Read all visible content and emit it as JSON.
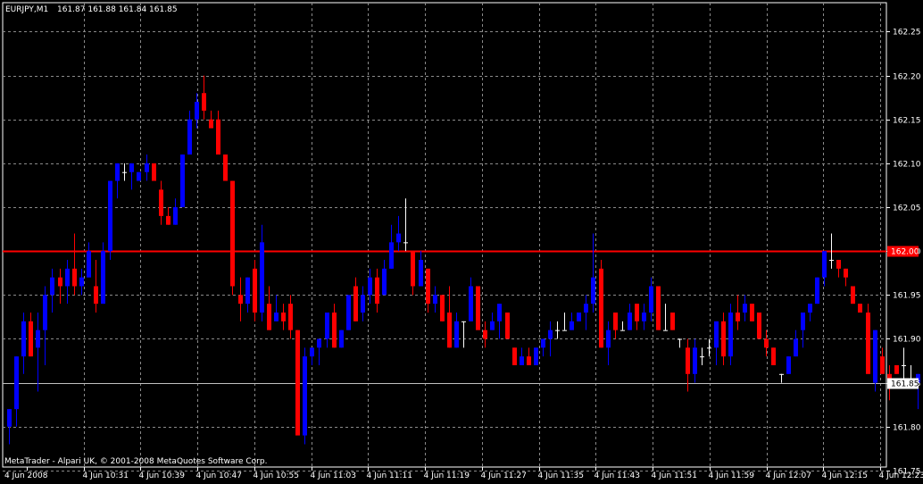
{
  "header": {
    "symbol": "EURJPY,M1",
    "ohlc": "161.87 161.88 161.84 161.85"
  },
  "footer": {
    "copyright": "MetaTrader - Alpari UK, © 2001-2008 MetaQuotes Software Corp."
  },
  "colors": {
    "background": "#000000",
    "grid": "#8a8a8a",
    "bull": "#0000ff",
    "bear": "#ff0000",
    "doji": "#ffffff",
    "level_line": "#ff0000",
    "bid_line": "#c0c0c0",
    "text": "#ffffff"
  },
  "chart_data": {
    "type": "candlestick",
    "title": "EURJPY,M1",
    "ylim": [
      161.754,
      162.283
    ],
    "y_ticks": [
      "162.25",
      "162.20",
      "162.15",
      "162.10",
      "162.05",
      "162.00",
      "161.95",
      "161.90",
      "161.85",
      "161.80",
      "161.75"
    ],
    "x_labels": [
      "4 Jun 2008",
      "4 Jun 10:31",
      "4 Jun 10:39",
      "4 Jun 10:47",
      "4 Jun 10:55",
      "4 Jun 11:03",
      "4 Jun 11:11",
      "4 Jun 11:19",
      "4 Jun 11:27",
      "4 Jun 11:35",
      "4 Jun 11:43",
      "4 Jun 11:51",
      "4 Jun 11:59",
      "4 Jun 12:07",
      "4 Jun 12:15",
      "4 Jun 12:23"
    ],
    "level_line": {
      "value": 162.0,
      "label": "162.00"
    },
    "bid_line": {
      "value": 161.85,
      "label": "161.85"
    },
    "grid": true,
    "candles": [
      {
        "o": 161.8,
        "h": 161.82,
        "l": 161.78,
        "c": 161.82
      },
      {
        "o": 161.82,
        "h": 161.88,
        "l": 161.8,
        "c": 161.88
      },
      {
        "o": 161.88,
        "h": 161.93,
        "l": 161.86,
        "c": 161.92
      },
      {
        "o": 161.92,
        "h": 161.93,
        "l": 161.88,
        "c": 161.88
      },
      {
        "o": 161.89,
        "h": 161.93,
        "l": 161.84,
        "c": 161.91
      },
      {
        "o": 161.91,
        "h": 161.96,
        "l": 161.87,
        "c": 161.95
      },
      {
        "o": 161.95,
        "h": 161.98,
        "l": 161.93,
        "c": 161.97
      },
      {
        "o": 161.97,
        "h": 161.98,
        "l": 161.94,
        "c": 161.96
      },
      {
        "o": 161.96,
        "h": 161.99,
        "l": 161.94,
        "c": 161.98
      },
      {
        "o": 161.98,
        "h": 162.02,
        "l": 161.95,
        "c": 161.96
      },
      {
        "o": 161.96,
        "h": 161.98,
        "l": 161.95,
        "c": 161.97
      },
      {
        "o": 161.97,
        "h": 162.01,
        "l": 161.97,
        "c": 162.0
      },
      {
        "o": 161.96,
        "h": 161.99,
        "l": 161.93,
        "c": 161.94
      },
      {
        "o": 161.94,
        "h": 162.01,
        "l": 161.94,
        "c": 162.0
      },
      {
        "o": 162.0,
        "h": 162.08,
        "l": 161.99,
        "c": 162.08
      },
      {
        "o": 162.08,
        "h": 162.1,
        "l": 162.06,
        "c": 162.1
      },
      {
        "o": 162.09,
        "h": 162.1,
        "l": 162.08,
        "c": 162.09
      },
      {
        "o": 162.09,
        "h": 162.1,
        "l": 162.07,
        "c": 162.1
      },
      {
        "o": 162.08,
        "h": 162.09,
        "l": 162.08,
        "c": 162.09
      },
      {
        "o": 162.09,
        "h": 162.11,
        "l": 162.08,
        "c": 162.1
      },
      {
        "o": 162.1,
        "h": 162.1,
        "l": 162.08,
        "c": 162.08
      },
      {
        "o": 162.07,
        "h": 162.08,
        "l": 162.03,
        "c": 162.04
      },
      {
        "o": 162.04,
        "h": 162.05,
        "l": 162.03,
        "c": 162.03
      },
      {
        "o": 162.03,
        "h": 162.06,
        "l": 162.03,
        "c": 162.05
      },
      {
        "o": 162.05,
        "h": 162.11,
        "l": 162.05,
        "c": 162.11
      },
      {
        "o": 162.11,
        "h": 162.16,
        "l": 162.11,
        "c": 162.15
      },
      {
        "o": 162.15,
        "h": 162.18,
        "l": 162.14,
        "c": 162.17
      },
      {
        "o": 162.18,
        "h": 162.2,
        "l": 162.15,
        "c": 162.16
      },
      {
        "o": 162.15,
        "h": 162.16,
        "l": 162.14,
        "c": 162.14
      },
      {
        "o": 162.15,
        "h": 162.16,
        "l": 162.11,
        "c": 162.11
      },
      {
        "o": 162.11,
        "h": 162.11,
        "l": 162.08,
        "c": 162.08
      },
      {
        "o": 162.08,
        "h": 162.08,
        "l": 161.95,
        "c": 161.96
      },
      {
        "o": 161.95,
        "h": 161.97,
        "l": 161.92,
        "c": 161.94
      },
      {
        "o": 161.94,
        "h": 161.97,
        "l": 161.93,
        "c": 161.97
      },
      {
        "o": 161.98,
        "h": 161.99,
        "l": 161.92,
        "c": 161.93
      },
      {
        "o": 161.93,
        "h": 162.03,
        "l": 161.92,
        "c": 162.01
      },
      {
        "o": 161.94,
        "h": 161.96,
        "l": 161.91,
        "c": 161.91
      },
      {
        "o": 161.92,
        "h": 161.95,
        "l": 161.92,
        "c": 161.93
      },
      {
        "o": 161.93,
        "h": 161.94,
        "l": 161.91,
        "c": 161.92
      },
      {
        "o": 161.94,
        "h": 161.95,
        "l": 161.9,
        "c": 161.91
      },
      {
        "o": 161.91,
        "h": 161.91,
        "l": 161.8,
        "c": 161.79
      },
      {
        "o": 161.79,
        "h": 161.89,
        "l": 161.78,
        "c": 161.88
      },
      {
        "o": 161.88,
        "h": 161.89,
        "l": 161.87,
        "c": 161.89
      },
      {
        "o": 161.89,
        "h": 161.9,
        "l": 161.87,
        "c": 161.9
      },
      {
        "o": 161.9,
        "h": 161.93,
        "l": 161.89,
        "c": 161.93
      },
      {
        "o": 161.93,
        "h": 161.94,
        "l": 161.89,
        "c": 161.89
      },
      {
        "o": 161.89,
        "h": 161.91,
        "l": 161.89,
        "c": 161.91
      },
      {
        "o": 161.91,
        "h": 161.95,
        "l": 161.91,
        "c": 161.95
      },
      {
        "o": 161.96,
        "h": 161.97,
        "l": 161.92,
        "c": 161.92
      },
      {
        "o": 161.93,
        "h": 161.96,
        "l": 161.92,
        "c": 161.95
      },
      {
        "o": 161.95,
        "h": 161.98,
        "l": 161.94,
        "c": 161.97
      },
      {
        "o": 161.97,
        "h": 161.98,
        "l": 161.93,
        "c": 161.94
      },
      {
        "o": 161.95,
        "h": 161.99,
        "l": 161.95,
        "c": 161.98
      },
      {
        "o": 161.98,
        "h": 162.03,
        "l": 161.98,
        "c": 162.01
      },
      {
        "o": 162.01,
        "h": 162.04,
        "l": 162.0,
        "c": 162.02
      },
      {
        "o": 162.01,
        "h": 162.06,
        "l": 162.0,
        "c": 162.01
      },
      {
        "o": 162.0,
        "h": 162.0,
        "l": 161.95,
        "c": 161.96
      },
      {
        "o": 161.96,
        "h": 162.0,
        "l": 161.96,
        "c": 161.99
      },
      {
        "o": 161.98,
        "h": 161.98,
        "l": 161.93,
        "c": 161.94
      },
      {
        "o": 161.94,
        "h": 161.96,
        "l": 161.93,
        "c": 161.95
      },
      {
        "o": 161.95,
        "h": 161.95,
        "l": 161.92,
        "c": 161.92
      },
      {
        "o": 161.93,
        "h": 161.96,
        "l": 161.89,
        "c": 161.89
      },
      {
        "o": 161.89,
        "h": 161.93,
        "l": 161.89,
        "c": 161.92
      },
      {
        "o": 161.92,
        "h": 161.92,
        "l": 161.89,
        "c": 161.92
      },
      {
        "o": 161.92,
        "h": 161.97,
        "l": 161.92,
        "c": 161.96
      },
      {
        "o": 161.96,
        "h": 161.96,
        "l": 161.91,
        "c": 161.91
      },
      {
        "o": 161.91,
        "h": 161.92,
        "l": 161.89,
        "c": 161.9
      },
      {
        "o": 161.91,
        "h": 161.93,
        "l": 161.91,
        "c": 161.92
      },
      {
        "o": 161.92,
        "h": 161.94,
        "l": 161.9,
        "c": 161.94
      },
      {
        "o": 161.93,
        "h": 161.93,
        "l": 161.9,
        "c": 161.9
      },
      {
        "o": 161.89,
        "h": 161.89,
        "l": 161.87,
        "c": 161.87
      },
      {
        "o": 161.87,
        "h": 161.89,
        "l": 161.87,
        "c": 161.88
      },
      {
        "o": 161.88,
        "h": 161.89,
        "l": 161.87,
        "c": 161.87
      },
      {
        "o": 161.87,
        "h": 161.89,
        "l": 161.87,
        "c": 161.89
      },
      {
        "o": 161.89,
        "h": 161.9,
        "l": 161.88,
        "c": 161.9
      },
      {
        "o": 161.9,
        "h": 161.92,
        "l": 161.88,
        "c": 161.91
      },
      {
        "o": 161.91,
        "h": 161.92,
        "l": 161.9,
        "c": 161.91
      },
      {
        "o": 161.91,
        "h": 161.93,
        "l": 161.91,
        "c": 161.91
      },
      {
        "o": 161.91,
        "h": 161.93,
        "l": 161.91,
        "c": 161.92
      },
      {
        "o": 161.92,
        "h": 161.93,
        "l": 161.92,
        "c": 161.93
      },
      {
        "o": 161.93,
        "h": 161.95,
        "l": 161.91,
        "c": 161.94
      },
      {
        "o": 161.94,
        "h": 162.02,
        "l": 161.93,
        "c": 161.97
      },
      {
        "o": 161.98,
        "h": 161.99,
        "l": 161.89,
        "c": 161.89
      },
      {
        "o": 161.89,
        "h": 161.92,
        "l": 161.87,
        "c": 161.91
      },
      {
        "o": 161.93,
        "h": 161.93,
        "l": 161.9,
        "c": 161.91
      },
      {
        "o": 161.91,
        "h": 161.92,
        "l": 161.91,
        "c": 161.91
      },
      {
        "o": 161.91,
        "h": 161.94,
        "l": 161.91,
        "c": 161.93
      },
      {
        "o": 161.94,
        "h": 161.94,
        "l": 161.91,
        "c": 161.92
      },
      {
        "o": 161.92,
        "h": 161.94,
        "l": 161.91,
        "c": 161.93
      },
      {
        "o": 161.93,
        "h": 161.97,
        "l": 161.92,
        "c": 161.96
      },
      {
        "o": 161.96,
        "h": 161.96,
        "l": 161.91,
        "c": 161.91
      },
      {
        "o": 161.91,
        "h": 161.94,
        "l": 161.91,
        "c": 161.91
      },
      {
        "o": 161.93,
        "h": 161.93,
        "l": 161.91,
        "c": 161.91
      },
      {
        "o": 161.9,
        "h": 161.9,
        "l": 161.89,
        "c": 161.9
      },
      {
        "o": 161.89,
        "h": 161.9,
        "l": 161.84,
        "c": 161.86
      },
      {
        "o": 161.86,
        "h": 161.9,
        "l": 161.85,
        "c": 161.89
      },
      {
        "o": 161.88,
        "h": 161.89,
        "l": 161.87,
        "c": 161.88
      },
      {
        "o": 161.89,
        "h": 161.9,
        "l": 161.88,
        "c": 161.89
      },
      {
        "o": 161.89,
        "h": 161.92,
        "l": 161.87,
        "c": 161.92
      },
      {
        "o": 161.92,
        "h": 161.93,
        "l": 161.87,
        "c": 161.88
      },
      {
        "o": 161.88,
        "h": 161.94,
        "l": 161.87,
        "c": 161.93
      },
      {
        "o": 161.93,
        "h": 161.95,
        "l": 161.91,
        "c": 161.92
      },
      {
        "o": 161.93,
        "h": 161.95,
        "l": 161.92,
        "c": 161.94
      },
      {
        "o": 161.94,
        "h": 161.94,
        "l": 161.92,
        "c": 161.92
      },
      {
        "o": 161.93,
        "h": 161.93,
        "l": 161.9,
        "c": 161.9
      },
      {
        "o": 161.9,
        "h": 161.91,
        "l": 161.88,
        "c": 161.89
      },
      {
        "o": 161.89,
        "h": 161.89,
        "l": 161.87,
        "c": 161.87
      },
      {
        "o": 161.86,
        "h": 161.86,
        "l": 161.85,
        "c": 161.86
      },
      {
        "o": 161.86,
        "h": 161.88,
        "l": 161.86,
        "c": 161.88
      },
      {
        "o": 161.88,
        "h": 161.91,
        "l": 161.88,
        "c": 161.9
      },
      {
        "o": 161.91,
        "h": 161.93,
        "l": 161.89,
        "c": 161.93
      },
      {
        "o": 161.93,
        "h": 161.94,
        "l": 161.92,
        "c": 161.94
      },
      {
        "o": 161.94,
        "h": 161.97,
        "l": 161.94,
        "c": 161.97
      },
      {
        "o": 161.97,
        "h": 162.0,
        "l": 161.96,
        "c": 162.0
      },
      {
        "o": 161.99,
        "h": 162.02,
        "l": 161.98,
        "c": 161.99
      },
      {
        "o": 161.99,
        "h": 161.99,
        "l": 161.97,
        "c": 161.98
      },
      {
        "o": 161.98,
        "h": 161.98,
        "l": 161.96,
        "c": 161.97
      },
      {
        "o": 161.96,
        "h": 161.96,
        "l": 161.94,
        "c": 161.94
      },
      {
        "o": 161.94,
        "h": 161.94,
        "l": 161.93,
        "c": 161.93
      },
      {
        "o": 161.93,
        "h": 161.94,
        "l": 161.86,
        "c": 161.86
      },
      {
        "o": 161.85,
        "h": 161.91,
        "l": 161.84,
        "c": 161.91
      },
      {
        "o": 161.88,
        "h": 161.89,
        "l": 161.86,
        "c": 161.86
      },
      {
        "o": 161.86,
        "h": 161.87,
        "l": 161.83,
        "c": 161.85
      },
      {
        "o": 161.87,
        "h": 161.87,
        "l": 161.86,
        "c": 161.86
      },
      {
        "o": 161.87,
        "h": 161.89,
        "l": 161.85,
        "c": 161.87
      },
      {
        "o": 161.85,
        "h": 161.87,
        "l": 161.85,
        "c": 161.85
      },
      {
        "o": 161.85,
        "h": 161.86,
        "l": 161.82,
        "c": 161.86
      },
      {
        "o": 161.86,
        "h": 161.86,
        "l": 161.82,
        "c": 161.84
      },
      {
        "o": 161.84,
        "h": 161.88,
        "l": 161.83,
        "c": 161.88
      },
      {
        "o": 161.87,
        "h": 161.87,
        "l": 161.84,
        "c": 161.85
      }
    ]
  }
}
